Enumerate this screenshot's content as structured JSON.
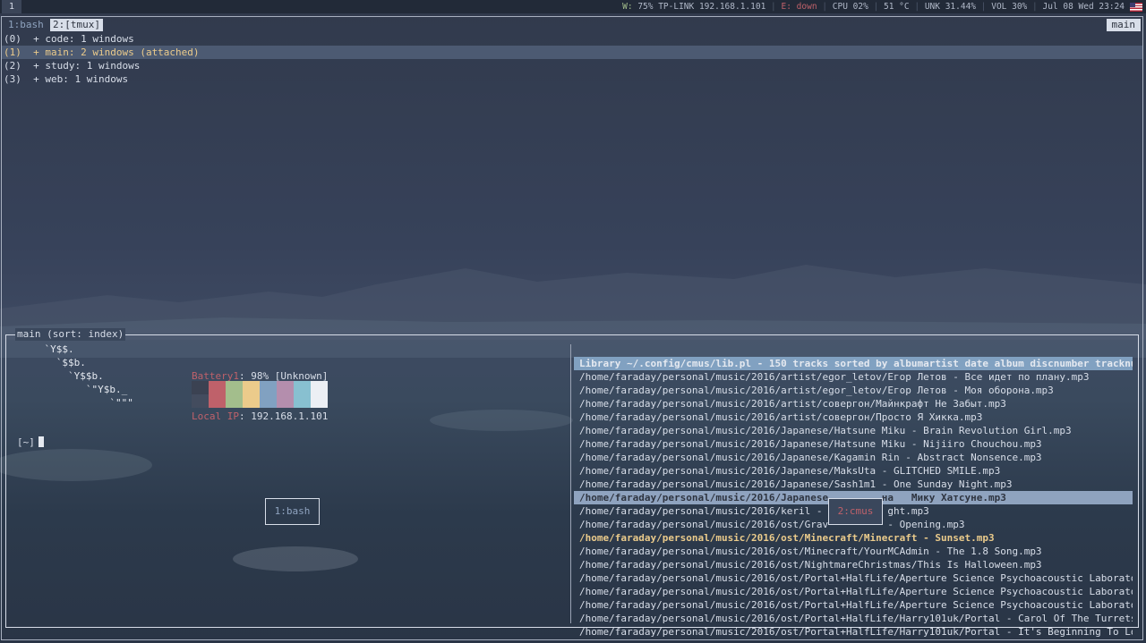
{
  "topbar": {
    "workspace": "1",
    "wifi_label": "W:",
    "wifi_value": "75% TP-LINK 192.168.1.101",
    "eth": "E: down",
    "cpu": "CPU 02%",
    "temp": "51 °C",
    "unk": "UNK 31.44%",
    "vol": "VOL 30%",
    "datetime": "Jul 08 Wed 23:24"
  },
  "tmux": {
    "tabs": [
      "1:bash",
      "2:[tmux]"
    ],
    "session_name": "main",
    "sessions": [
      "(0)  + code: 1 windows",
      "(1)  + main: 2 windows (attached)",
      "(2)  + study: 1 windows",
      "(3)  + web: 1 windows"
    ],
    "tree_label": "main (sort: index)"
  },
  "fetch": {
    "ascii": [
      "    `Y$$.",
      "      `$$b.",
      "        `Y$$b.",
      "           `\"Y$b._",
      "               `\"\"\""
    ],
    "battery_label": "Battery1",
    "battery_value": ": 98% [Unknown]",
    "ip_label": "Local IP",
    "ip_value": ": 192.168.1.101",
    "swatches": [
      "#bf616a",
      "#a3be8c",
      "#ebcb8b",
      "#81a1c1",
      "#b48ead",
      "#88c0d0",
      "#eceff4"
    ]
  },
  "prompt": "[~]",
  "pane_labels": {
    "left": "1:bash",
    "right": "2:cmus"
  },
  "cmus": {
    "header": "Library ~/.config/cmus/lib.pl - 150 tracks sorted by albumartist date album discnumber tracknu",
    "rows": [
      "/home/faraday/personal/music/2016/artist/egor_letov/Егор Летов - Все идет по плану.mp3",
      "/home/faraday/personal/music/2016/artist/egor_letov/Егор Летов - Моя оборона.mp3",
      "/home/faraday/personal/music/2016/artist/совергон/Майнкрафт Не Забыт.mp3",
      "/home/faraday/personal/music/2016/artist/совергон/Просто Я Хикка.mp3",
      "/home/faraday/personal/music/2016/Japanese/Hatsune Miku - Brain Revolution Girl.mp3",
      "/home/faraday/personal/music/2016/Japanese/Hatsune Miku - Nijiiro Chouchou.mp3",
      "/home/faraday/personal/music/2016/Japanese/Kagamin Rin - Abstract Nonsence.mp3",
      "/home/faraday/personal/music/2016/Japanese/MaksUta - GLITCHED SMILE.mp3",
      "/home/faraday/personal/music/2016/Japanese/Sash1m1 - One Sunday Night.mp3",
      "/home/faraday/personal/music/2016/Japanese         на   Мику Хатсуне.mp3",
      "/home/faraday/personal/music/2016/keril -           ght.mp3",
      "/home/faraday/personal/music/2016/ost/Grav          - Opening.mp3",
      "/home/faraday/personal/music/2016/ost/Minecraft/Minecraft - Sunset.mp3",
      "/home/faraday/personal/music/2016/ost/Minecraft/YourMCAdmin - The 1.8 Song.mp3",
      "/home/faraday/personal/music/2016/ost/NightmareChristmas/This Is Halloween.mp3",
      "/home/faraday/personal/music/2016/ost/Portal+HalfLife/Aperture Science Psychoacoustic Laborato",
      "/home/faraday/personal/music/2016/ost/Portal+HalfLife/Aperture Science Psychoacoustic Laborato",
      "/home/faraday/personal/music/2016/ost/Portal+HalfLife/Aperture Science Psychoacoustic Laborato",
      "/home/faraday/personal/music/2016/ost/Portal+HalfLife/Harry101uk/Portal - Carol Of The Turrets",
      "/home/faraday/personal/music/2016/ost/Portal+HalfLife/Harry101uk/Portal - It's Beginning To Lo"
    ],
    "cursor_row": 9,
    "playing_row": 12
  }
}
